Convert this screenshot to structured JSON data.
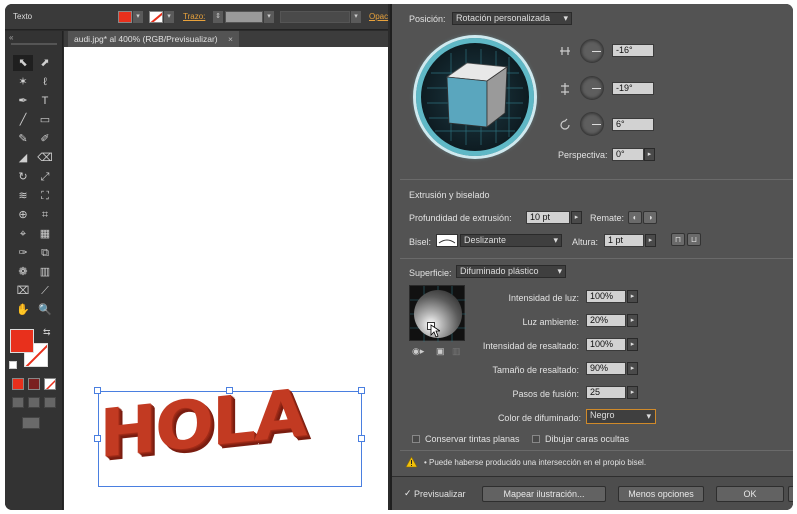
{
  "control_bar": {
    "tool_label": "Texto",
    "stroke_label": "Trazo:",
    "fill_color": "#e8301c",
    "opacity_label": "Opac"
  },
  "document": {
    "tab_title": "audi.jpg* al 400% (RGB/Previsualizar)",
    "close_glyph": "×",
    "artwork_text": "HOLA",
    "artwork_color": "#b8331c"
  },
  "toolbar": {
    "fill_color": "#e8301c",
    "tools": [
      "selection-tool",
      "direct-selection-tool",
      "magic-wand-tool",
      "lasso-tool",
      "pen-tool",
      "type-tool",
      "line-tool",
      "rectangle-tool",
      "paintbrush-tool",
      "pencil-tool",
      "blob-brush-tool",
      "eraser-tool",
      "rotate-tool",
      "scale-tool",
      "warp-tool",
      "free-transform-tool",
      "shape-builder-tool",
      "perspective-grid-tool",
      "mesh-tool",
      "gradient-tool",
      "eyedropper-tool",
      "blend-tool",
      "symbol-sprayer-tool",
      "column-graph-tool",
      "artboard-tool",
      "slice-tool",
      "hand-tool",
      "zoom-tool"
    ],
    "glyphs": [
      "⬉",
      "⬈",
      "✶",
      "ℓ",
      "✒",
      "T",
      "╱",
      "▭",
      "✎",
      "✐",
      "◢",
      "⌫",
      "↻",
      "⤢",
      "≋",
      "⛶",
      "⊕",
      "⌗",
      "⌖",
      "▦",
      "✑",
      "⧉",
      "❁",
      "▥",
      "⌧",
      "⟋",
      "✋",
      "🔍"
    ]
  },
  "dialog": {
    "position": {
      "label": "Posición:",
      "value": "Rotación personalizada",
      "rot_x": "-16°",
      "rot_y": "-19°",
      "rot_z": "6°",
      "perspective_label": "Perspectiva:",
      "perspective_value": "0°",
      "cube_face_color": "#5aa6be",
      "ring_color": "#5fb8c6"
    },
    "extrude": {
      "section_title": "Extrusión y biselado",
      "depth_label": "Profundidad de extrusión:",
      "depth_value": "10 pt",
      "cap_label": "Remate:",
      "bevel_label": "Bisel:",
      "bevel_value": "Deslizante",
      "height_label": "Altura:",
      "height_value": "1 pt"
    },
    "surface": {
      "label": "Superficie:",
      "value": "Difuminado plástico",
      "light_intensity_label": "Intensidad de luz:",
      "light_intensity_value": "100%",
      "ambient_label": "Luz ambiente:",
      "ambient_value": "20%",
      "highlight_intensity_label": "Intensidad de resaltado:",
      "highlight_intensity_value": "100%",
      "highlight_size_label": "Tamaño de resaltado:",
      "highlight_size_value": "90%",
      "blend_steps_label": "Pasos de fusión:",
      "blend_steps_value": "25",
      "shading_color_label": "Color de difuminado:",
      "shading_color_value": "Negro",
      "preserve_spot_label": "Conservar tintas planas",
      "draw_hidden_label": "Dibujar caras ocultas"
    },
    "warning": "• Puede haberse producido una intersección en el propio bisel.",
    "preview_label": "Previsualizar",
    "map_art_button": "Mapear ilustración...",
    "fewer_options_button": "Menos opciones",
    "ok_button": "OK"
  }
}
